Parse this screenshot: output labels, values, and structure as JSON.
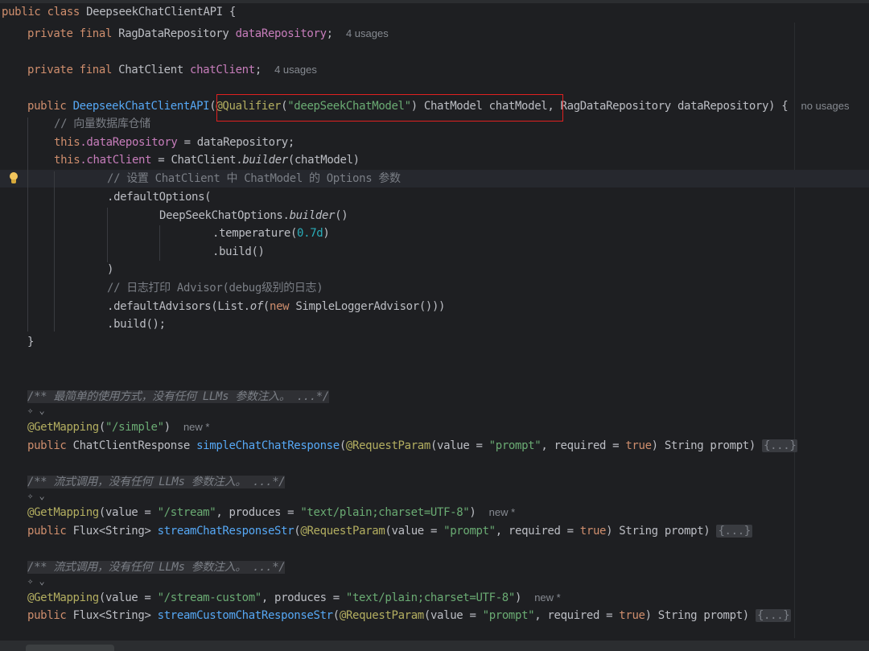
{
  "colors": {
    "background": "#1e1f22",
    "keyword": "#cf8e6d",
    "field": "#c77dbb",
    "method": "#56a8f5",
    "annotation": "#b3ae60",
    "string": "#6aab73",
    "number": "#2aacb8",
    "comment": "#7a7e85",
    "highlight_box": "#e02020"
  },
  "icons": {
    "bulb": "lightbulb-icon",
    "ai": "ai-assistant-icon"
  },
  "code": {
    "class_decl": {
      "kw1": "public",
      "kw2": "class",
      "name": "DeepseekChatClientAPI",
      "brace": "{"
    },
    "field1": {
      "kw": "private final",
      "type": "RagDataRepository",
      "name": "dataRepository",
      "semi": ";",
      "hint": "4 usages"
    },
    "field2": {
      "kw": "private final",
      "type": "ChatClient",
      "name": "chatClient",
      "semi": ";",
      "hint": "4 usages"
    },
    "ctor": {
      "kw": "public",
      "name": "DeepseekChatClientAPI",
      "open": "(",
      "annotation": "@Qualifier",
      "ann_open": "(",
      "qualifier": "\"deepSeekChatModel\"",
      "ann_close_args": ") ChatModel chatModel,",
      "rest": " RagDataRepository dataRepository) {",
      "hint": "no usages"
    },
    "comment_repo": "// 向量数据库仓储",
    "assign_repo": {
      "this": "this",
      "dot_field": ".dataRepository",
      "rest": " = dataRepository;"
    },
    "assign_client": {
      "this": "this",
      "dot_field": ".chatClient",
      "mid": " = ChatClient.",
      "builder": "builder",
      "rest": "(chatModel)"
    },
    "comment_options": "// 设置 ChatClient 中 ChatModel 的 Options 参数",
    "default_options": ".defaultOptions(",
    "options_builder": {
      "cls": "DeepSeekChatOptions.",
      "builder": "builder",
      "rest": "()"
    },
    "temperature": {
      "call": ".temperature(",
      "value": "0.7d",
      "close": ")"
    },
    "build_inner": ".build()",
    "close_paren": ")",
    "comment_advisor": "// 日志打印 Advisor(debug级别的日志)",
    "default_advisors": {
      "call": ".defaultAdvisors(List.",
      "of": "of",
      "open": "(",
      "new": "new",
      "rest": " SimpleLoggerAdvisor()))"
    },
    "build_final": ".build();",
    "ctor_close": "}",
    "methods": [
      {
        "doc": "/** 最简单的使用方式，没有任何 LLMs 参数注入。 ...*/",
        "ai": "✧ ⌄",
        "annotation": "@GetMapping",
        "args_pre": "(",
        "arg1_name": "",
        "arg1_val": "\"/simple\"",
        "arg2_name": "",
        "arg2_val": "",
        "args_close": ")",
        "hint": "new *",
        "kw": "public",
        "return_type": "ChatClientResponse",
        "name": "simpleChatChatResponse",
        "param_ann": "@RequestParam",
        "p1": "(value = ",
        "p_val": "\"prompt\"",
        "p2": ", required = ",
        "p_bool": "true",
        "p3": ") String prompt) ",
        "fold": "{...}"
      },
      {
        "doc": "/** 流式调用，没有任何 LLMs 参数注入。 ...*/",
        "ai": "✧ ⌄",
        "annotation": "@GetMapping",
        "args_pre": "(value = ",
        "arg1_val": "\"/stream\"",
        "arg2_name": ", produces = ",
        "arg2_val": "\"text/plain;charset=UTF-8\"",
        "args_close": ")",
        "hint": "new *",
        "kw": "public",
        "return_type": "Flux<String>",
        "name": "streamChatResponseStr",
        "param_ann": "@RequestParam",
        "p1": "(value = ",
        "p_val": "\"prompt\"",
        "p2": ", required = ",
        "p_bool": "true",
        "p3": ") String prompt) ",
        "fold": "{...}"
      },
      {
        "doc": "/** 流式调用，没有任何 LLMs 参数注入。 ...*/",
        "ai": "✧ ⌄",
        "annotation": "@GetMapping",
        "args_pre": "(value = ",
        "arg1_val": "\"/stream-custom\"",
        "arg2_name": ", produces = ",
        "arg2_val": "\"text/plain;charset=UTF-8\"",
        "args_close": ")",
        "hint": "new *",
        "kw": "public",
        "return_type": "Flux<String>",
        "name": "streamCustomChatResponseStr",
        "param_ann": "@RequestParam",
        "p1": "(value = ",
        "p_val": "\"prompt\"",
        "p2": ", required = ",
        "p_bool": "true",
        "p3": ") String prompt) ",
        "fold": "{...}"
      }
    ]
  }
}
